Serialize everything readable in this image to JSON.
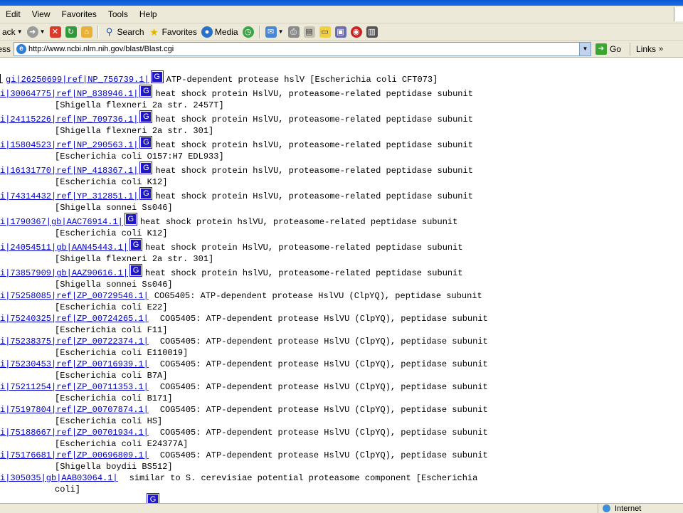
{
  "menubar": {
    "items": [
      "Edit",
      "View",
      "Favorites",
      "Tools",
      "Help"
    ]
  },
  "toolbar": {
    "back_label": "ack",
    "search_label": "Search",
    "favorites_label": "Favorites",
    "media_label": "Media"
  },
  "addressbar": {
    "label": "ess",
    "url": "http://www.ncbi.nlm.nih.gov/blast/Blast.cgi",
    "go_label": "Go",
    "links_label": "Links"
  },
  "hits": [
    {
      "id": "gi|26250699|ref|NP_756739.1|",
      "desc": "ATP-dependent protease hslV [Escherichia coli CFT073]",
      "org": ""
    },
    {
      "id": "i|30064775|ref|NP_838946.1|",
      "desc": "heat shock protein HslVU, proteasome-related peptidase subunit",
      "org": "[Shigella flexneri 2a str. 2457T]"
    },
    {
      "id": "i|24115226|ref|NP_709736.1|",
      "desc": "heat shock protein HslVU, proteasome-related peptidase subunit",
      "org": "[Shigella flexneri 2a str. 301]"
    },
    {
      "id": "i|15804523|ref|NP_290563.1|",
      "desc": "heat shock protein hslVU, proteasome-related peptidase subunit",
      "org": "[Escherichia coli O157:H7 EDL933]"
    },
    {
      "id": "i|16131770|ref|NP_418367.1|",
      "desc": "heat shock protein hslVU, proteasome-related peptidase subunit",
      "org": "[Escherichia coli K12]"
    },
    {
      "id": "i|74314432|ref|YP_312851.1|",
      "desc": "heat shock protein HslVU, proteasome-related peptidase subunit",
      "org": "[Shigella sonnei Ss046]"
    },
    {
      "id": "i|1790367|gb|AAC76914.1|",
      "desc": "heat shock protein hslVU, proteasome-related peptidase subunit",
      "org": "[Escherichia coli K12]"
    },
    {
      "id": "i|24054511|gb|AAN45443.1|",
      "desc": "heat shock protein HslVU, proteasome-related peptidase subunit",
      "org": "[Shigella flexneri 2a str. 301]"
    },
    {
      "id": "i|73857909|gb|AAZ90616.1|",
      "desc": "heat shock protein hslVU, proteasome-related peptidase subunit",
      "org": "[Shigella sonnei Ss046]"
    },
    {
      "id": "i|75258085|ref|ZP_00729546.1|",
      "desc": "COG5405: ATP-dependent protease HslVU (ClpYQ), peptidase subunit",
      "org": "[Escherichia coli E22]"
    },
    {
      "id": "i|75240325|ref|ZP_00724265.1|",
      "desc": "COG5405: ATP-dependent protease HslVU (ClpYQ), peptidase subunit",
      "org": "[Escherichia coli F11]"
    },
    {
      "id": "i|75238375|ref|ZP_00722374.1|",
      "desc": "COG5405: ATP-dependent protease HslVU (ClpYQ), peptidase subunit",
      "org": "[Escherichia coli E110019]"
    },
    {
      "id": "i|75230453|ref|ZP_00716939.1|",
      "desc": "COG5405: ATP-dependent protease HslVU (ClpYQ), peptidase subunit",
      "org": "[Escherichia coli B7A]"
    },
    {
      "id": "i|75211254|ref|ZP_00711353.1|",
      "desc": "COG5405: ATP-dependent protease HslVU (ClpYQ), peptidase subunit",
      "org": "[Escherichia coli B171]"
    },
    {
      "id": "i|75197804|ref|ZP_00707874.1|",
      "desc": "COG5405: ATP-dependent protease HslVU (ClpYQ), peptidase subunit",
      "org": "[Escherichia coli HS]"
    },
    {
      "id": "i|75188667|ref|ZP_00701934.1|",
      "desc": "COG5405: ATP-dependent protease HslVU (ClpYQ), peptidase subunit",
      "org": "[Escherichia coli E24377A]"
    },
    {
      "id": "i|75176681|ref|ZP_00696809.1|",
      "desc": "COG5405: ATP-dependent protease HslVU (ClpYQ), peptidase subunit",
      "org": "[Shigella boydii BS512]"
    },
    {
      "id": "i|305035|gb|AAB03064.1|",
      "desc": "similar to S. cerevisiae potential proteasome component [Escherichia",
      "org": "coli]"
    }
  ],
  "g_label": "G",
  "statusbar": {
    "zone_label": "Internet"
  }
}
